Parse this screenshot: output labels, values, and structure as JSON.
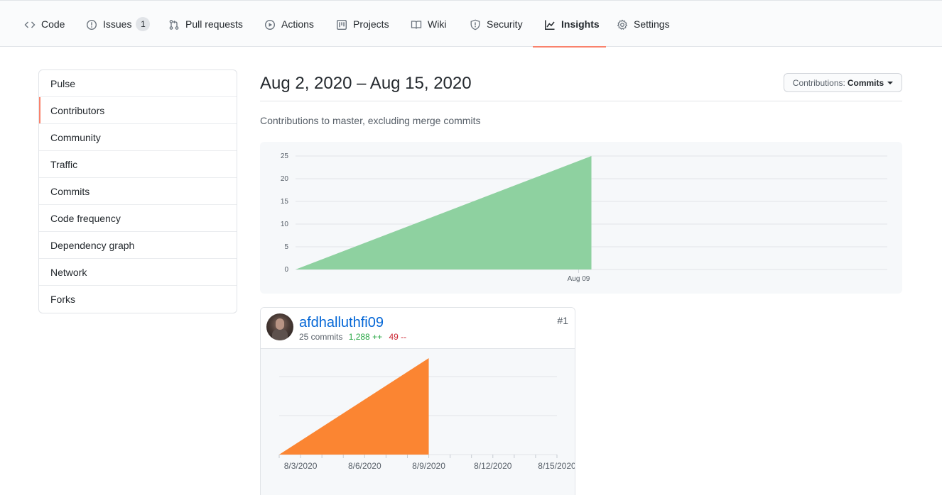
{
  "tabs": [
    {
      "label": "Code",
      "icon": "code-icon"
    },
    {
      "label": "Issues",
      "icon": "issue-opened-icon",
      "counter": "1"
    },
    {
      "label": "Pull requests",
      "icon": "git-pull-request-icon"
    },
    {
      "label": "Actions",
      "icon": "play-icon"
    },
    {
      "label": "Projects",
      "icon": "project-icon"
    },
    {
      "label": "Wiki",
      "icon": "book-icon"
    },
    {
      "label": "Security",
      "icon": "shield-icon"
    },
    {
      "label": "Insights",
      "icon": "graph-icon",
      "selected": true
    },
    {
      "label": "Settings",
      "icon": "gear-icon"
    }
  ],
  "sidebar": {
    "items": [
      {
        "label": "Pulse"
      },
      {
        "label": "Contributors",
        "selected": true
      },
      {
        "label": "Community"
      },
      {
        "label": "Traffic"
      },
      {
        "label": "Commits"
      },
      {
        "label": "Code frequency"
      },
      {
        "label": "Dependency graph"
      },
      {
        "label": "Network"
      },
      {
        "label": "Forks"
      }
    ]
  },
  "main": {
    "date_range": "Aug 2, 2020 – Aug 15, 2020",
    "contributions_label": "Contributions:",
    "contributions_value": "Commits",
    "subtitle": "Contributions to master, excluding merge commits"
  },
  "contributor": {
    "username": "afdhalluthfi09",
    "commits": "25 commits",
    "additions": "1,288 ++",
    "deletions": "49 --",
    "rank": "#1"
  },
  "colors": {
    "accent_tab": "#f9826c",
    "main_area": "#8ed1a0",
    "user_area": "#fb8532",
    "link": "#0366d6",
    "additions": "#28a745",
    "deletions": "#cb2431"
  },
  "chart_data": [
    {
      "type": "area",
      "title": "",
      "xlabel": "",
      "ylabel": "",
      "x": [
        "2020-08-02",
        "2020-08-09"
      ],
      "y": [
        0,
        25
      ],
      "x_tick_labels": [
        "Aug 09"
      ],
      "y_ticks": [
        0,
        5,
        10,
        15,
        20,
        25
      ],
      "ylim": [
        0,
        25
      ],
      "xlim": [
        "2020-08-02",
        "2020-08-16"
      ],
      "grid": true
    },
    {
      "type": "area",
      "title": "",
      "xlabel": "",
      "ylabel": "",
      "x": [
        "2020-08-02",
        "2020-08-09"
      ],
      "y": [
        0,
        25
      ],
      "x_tick_labels": [
        "8/3/2020",
        "8/6/2020",
        "8/9/2020",
        "8/12/2020",
        "8/15/2020"
      ],
      "ylim": [
        0,
        25
      ],
      "xlim": [
        "2020-08-02",
        "2020-08-15"
      ],
      "grid": true
    }
  ]
}
